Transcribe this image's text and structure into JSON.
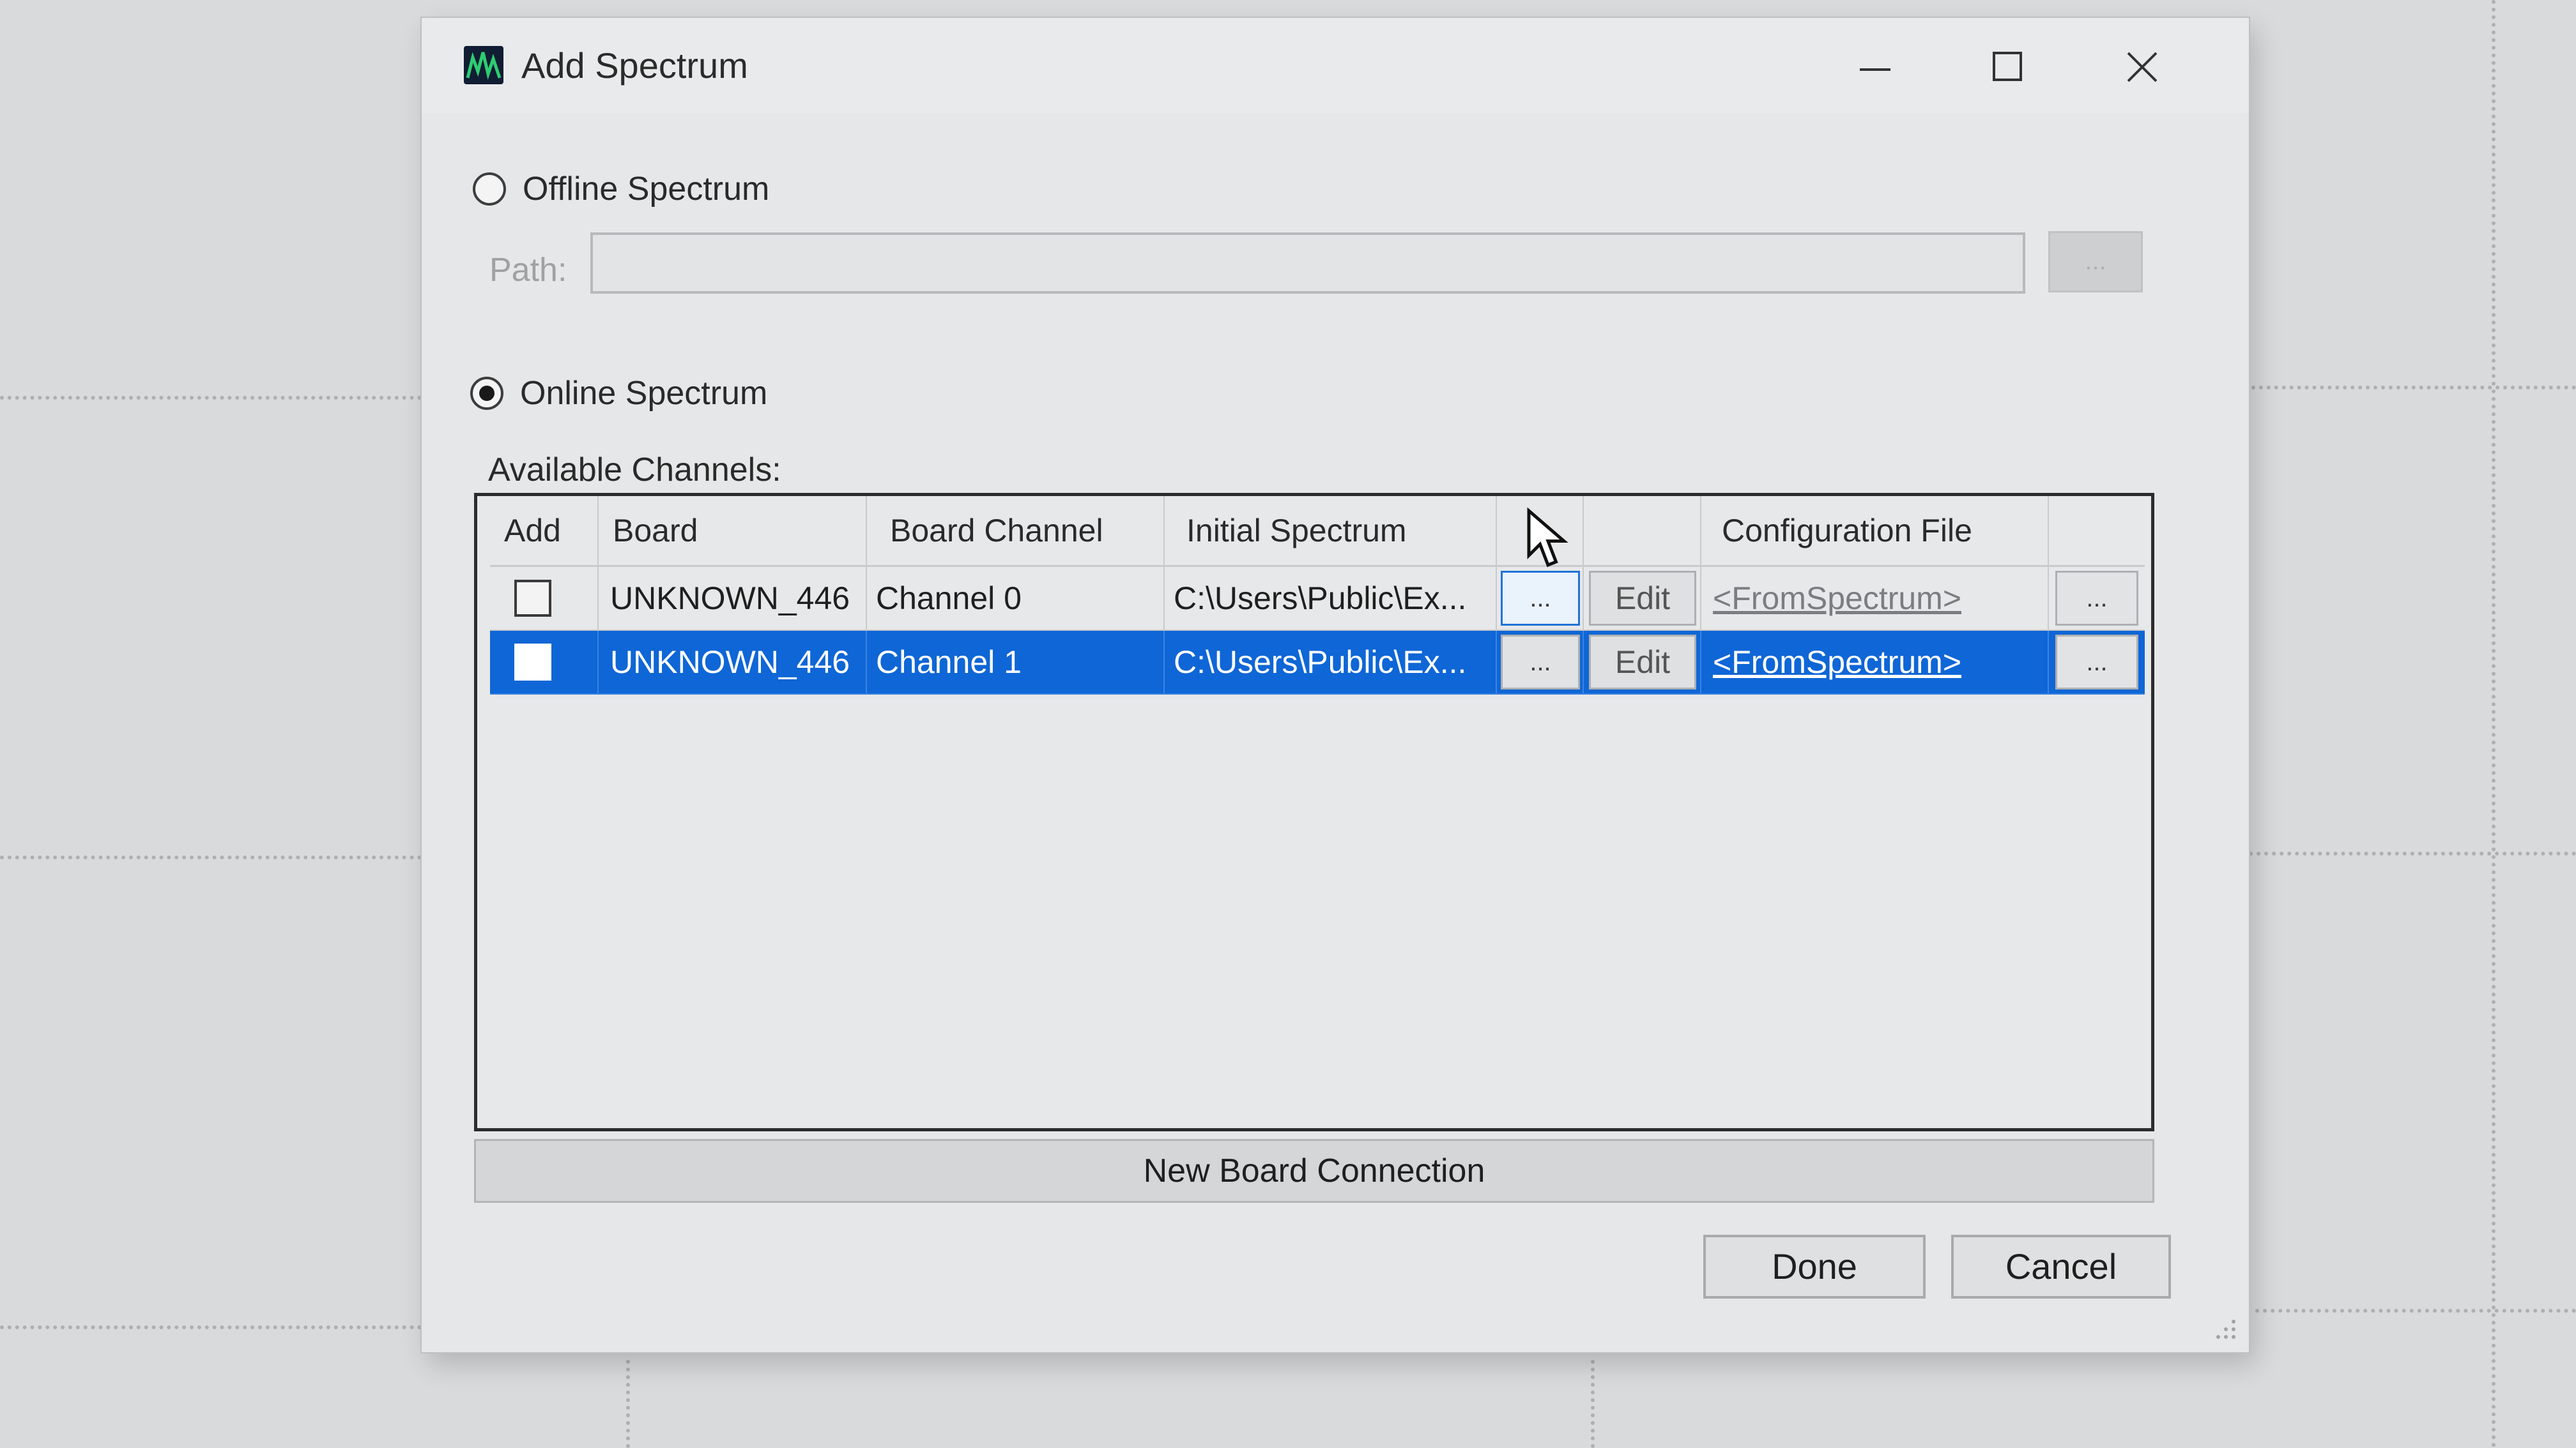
{
  "window": {
    "title": "Add Spectrum",
    "icon": "app-icon",
    "controls": [
      "minimize-icon",
      "maximize-icon",
      "close-icon"
    ]
  },
  "offline": {
    "label": "Offline Spectrum",
    "selected": false,
    "path_label": "Path:",
    "path_value": "",
    "browse_label": "..."
  },
  "online": {
    "label": "Online Spectrum",
    "selected": true
  },
  "channels": {
    "label": "Available Channels:",
    "columns": [
      "Add",
      "Board",
      "Board Channel",
      "Initial Spectrum",
      "",
      "",
      "Configuration File",
      ""
    ],
    "rows": [
      {
        "add": false,
        "board": "UNKNOWN_446",
        "board_channel": "Channel 0",
        "initial_spectrum": "C:\\Users\\Public\\Ex...",
        "browse": "...",
        "edit": "Edit",
        "config_file": "<FromSpectrum>",
        "config_browse": "...",
        "selected": false
      },
      {
        "add": false,
        "board": "UNKNOWN_446",
        "board_channel": "Channel 1",
        "initial_spectrum": "C:\\Users\\Public\\Ex...",
        "browse": "...",
        "edit": "Edit",
        "config_file": "<FromSpectrum>",
        "config_browse": "...",
        "selected": true
      }
    ]
  },
  "buttons": {
    "new_board": "New Board Connection",
    "done": "Done",
    "cancel": "Cancel"
  },
  "colors": {
    "selection": "#0f66d6",
    "window_bg": "#e6e7e8"
  }
}
